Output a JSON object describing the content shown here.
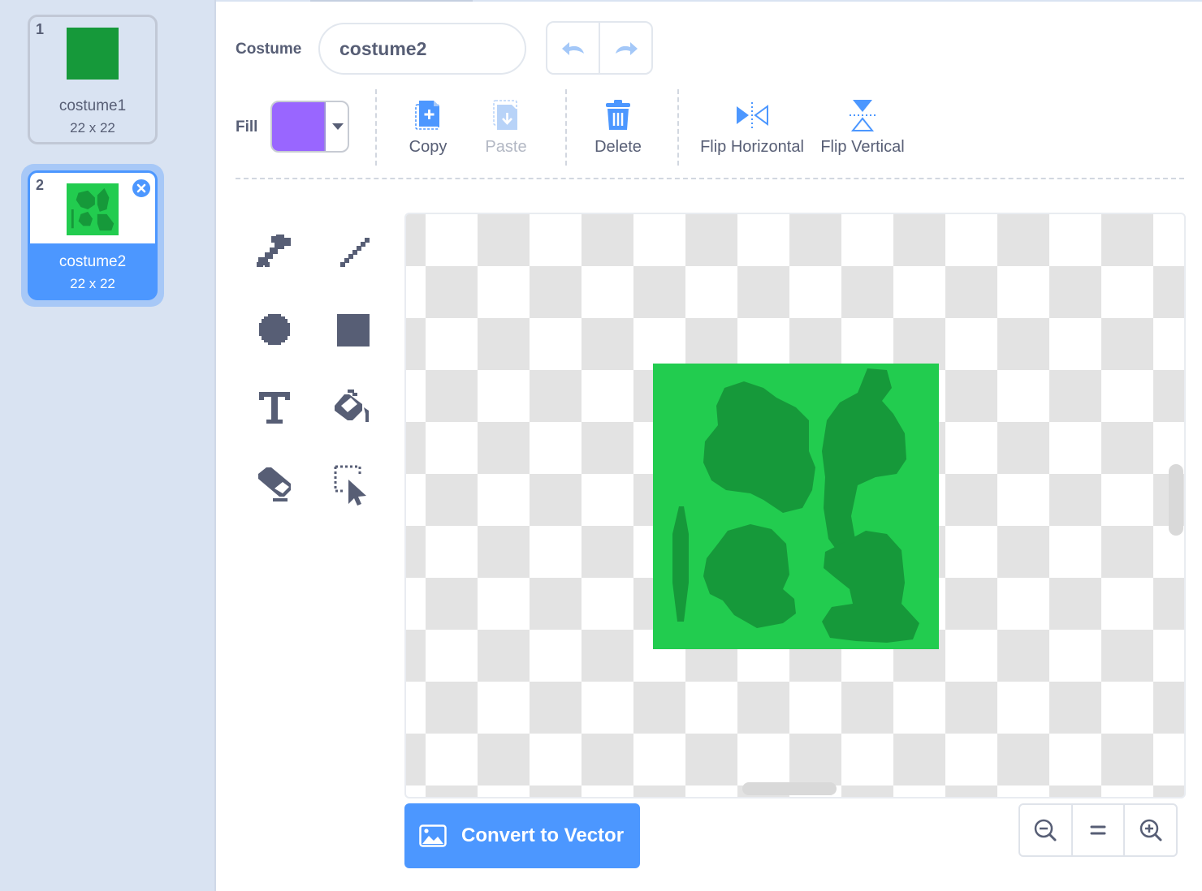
{
  "costumes": [
    {
      "number": "1",
      "name": "costume1",
      "size": "22 x 22",
      "selected": false,
      "color": "#16993a"
    },
    {
      "number": "2",
      "name": "costume2",
      "size": "22 x 22",
      "selected": true,
      "color": "#22cc4f"
    }
  ],
  "header": {
    "costume_label": "Costume",
    "costume_name": "costume2",
    "fill_label": "Fill",
    "fill_color": "#9966ff"
  },
  "actions": {
    "copy": "Copy",
    "paste": "Paste",
    "delete": "Delete",
    "flip_horizontal": "Flip Horizontal",
    "flip_vertical": "Flip Vertical"
  },
  "tools": [
    "brush-icon",
    "line-icon",
    "circle-icon",
    "rectangle-icon",
    "text-icon",
    "fill-icon",
    "eraser-icon",
    "select-icon"
  ],
  "convert_label": "Convert to Vector",
  "colors": {
    "accent": "#4c97ff",
    "costume_light": "#22cc4f",
    "costume_dark": "#16993a",
    "text": "#575e75"
  }
}
